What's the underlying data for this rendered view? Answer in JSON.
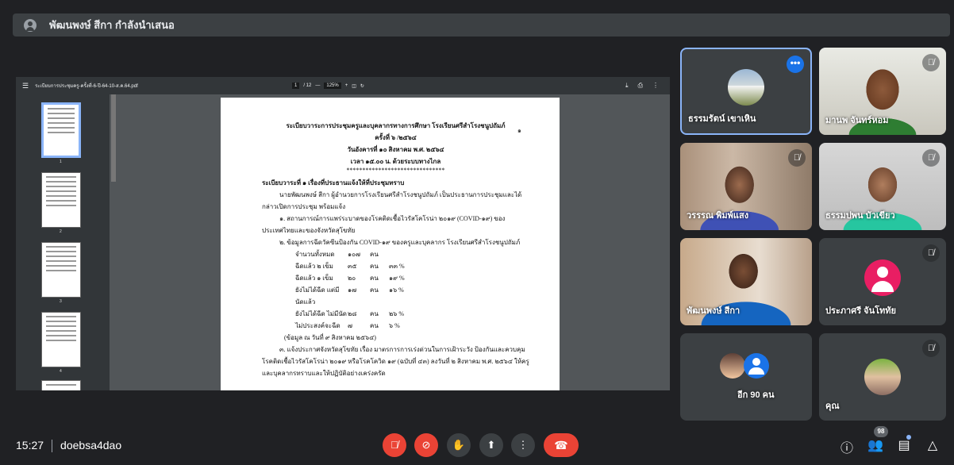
{
  "banner": {
    "title": "พัฒนพงษ์ สีกา กำลังนำเสนอ"
  },
  "pdf": {
    "filename": "ระเบียบการประชุมครู-ครั้งที่-6-ปี-64-10-ส.ค.64.pdf",
    "page_current": "1",
    "page_total": "/ 12",
    "zoom": "125%",
    "thumb_numbers": [
      "1",
      "2",
      "3",
      "4"
    ],
    "page_number": "๑",
    "heading1": "ระเบียบวาระการประชุมครูและบุคลากรทางการศึกษา โรงเรียนศรีสำโรงชนูปถัมภ์",
    "heading2": "ครั้งที่ ๖ /๒๕๖๔",
    "heading3": "วันอังคารที่ ๑๐ สิงหาคม พ.ศ. ๒๕๖๔",
    "heading4": "เวลา ๑๕.๐๐ น. ด้วยระบบทางไกล",
    "stars": "*******************************",
    "agenda1": "ระเบียบวาระที่ ๑ เรื่องที่ประธานแจ้งให้ที่ประชุมทราบ",
    "para1": "นายพัฒนพงษ์ สีกา ผู้อำนวยการโรงเรียนศรีสำโรงชนูปถัมภ์ เป็นประธานการประชุมและได้กล่าวเปิดการประชุม พร้อมแจ้ง",
    "para2": "๑. สถานการณ์การแพร่ระบาดของโรคติดเชื้อไวรัสโคโรน่า ๒๐๑๙ (COVID-๑๙) ของประเทศไทยและของจังหวัดสุโขทัย",
    "para3": "๒. ข้อมูลการฉีดวัคซีนป้องกัน COVID-๑๙ ของครูและบุคลากร โรงเรียนศรีสำโรงชนูปถัมภ์",
    "rows": [
      [
        "จำนวนทั้งหมด",
        "๑๐๗",
        "คน",
        ""
      ],
      [
        "ฉีดแล้ว ๒ เข็ม",
        "๓๕",
        "คน",
        "๓๓ %"
      ],
      [
        "ฉีดแล้ว ๑ เข็ม",
        "๒๐",
        "คน",
        "๑๙ %"
      ],
      [
        "ยังไม่ได้ฉีด แต่มีนัดแล้ว",
        "๑๗",
        "คน",
        "๑๖ %"
      ],
      [
        "ยังไม่ได้ฉีด ไม่มีนัด",
        "๒๘",
        "คน",
        "๒๖ %"
      ],
      [
        "ไม่ประสงค์จะฉีด",
        "๗",
        "คน",
        "๖ %"
      ]
    ],
    "note": "(ข้อมูล ณ วันที่ ๙ สิงหาคม ๒๕๖๔)",
    "para4": "๓. แจ้งประกาศจังหวัดสุโขทัย เรื่อง มาตรการการเร่งด่วนในการเฝ้าระวัง ป้องกันและควบคุมโรคติดเชื้อไวรัสโคโรน่า ๒๐๑๙ หรือโรคโควิด ๑๙ (ฉบับที่ ๔๓) ลงวันที่ ๒ สิงหาคม พ.ศ. ๒๕๖๔ ให้ครูและบุคลากรทราบและให้ปฏิบัติอย่างเคร่งครัด"
  },
  "participants": [
    {
      "name": "ธรรมรัตน์ เขาเหิน",
      "state": "active"
    },
    {
      "name": "มานพ จันทร์หอม",
      "state": "muted"
    },
    {
      "name": "วรรรณ พิมพ์แสง",
      "state": "muted"
    },
    {
      "name": "ธรรมปพน บัวเขียว",
      "state": "muted"
    },
    {
      "name": "พัฒนพงษ์ สีกา",
      "state": "speaking"
    },
    {
      "name": "ประภาศรี จันโททัย",
      "state": "muted"
    },
    {
      "name": "อีก 90 คน",
      "state": "group"
    },
    {
      "name": "คุณ",
      "state": "muted"
    }
  ],
  "bottom": {
    "time": "15:27",
    "meeting_code": "doebsa4dao",
    "participant_count": "98"
  },
  "colors": {
    "accent": "#8ab4f8",
    "danger": "#ea4335",
    "pink_avatar": "#e91e63"
  }
}
